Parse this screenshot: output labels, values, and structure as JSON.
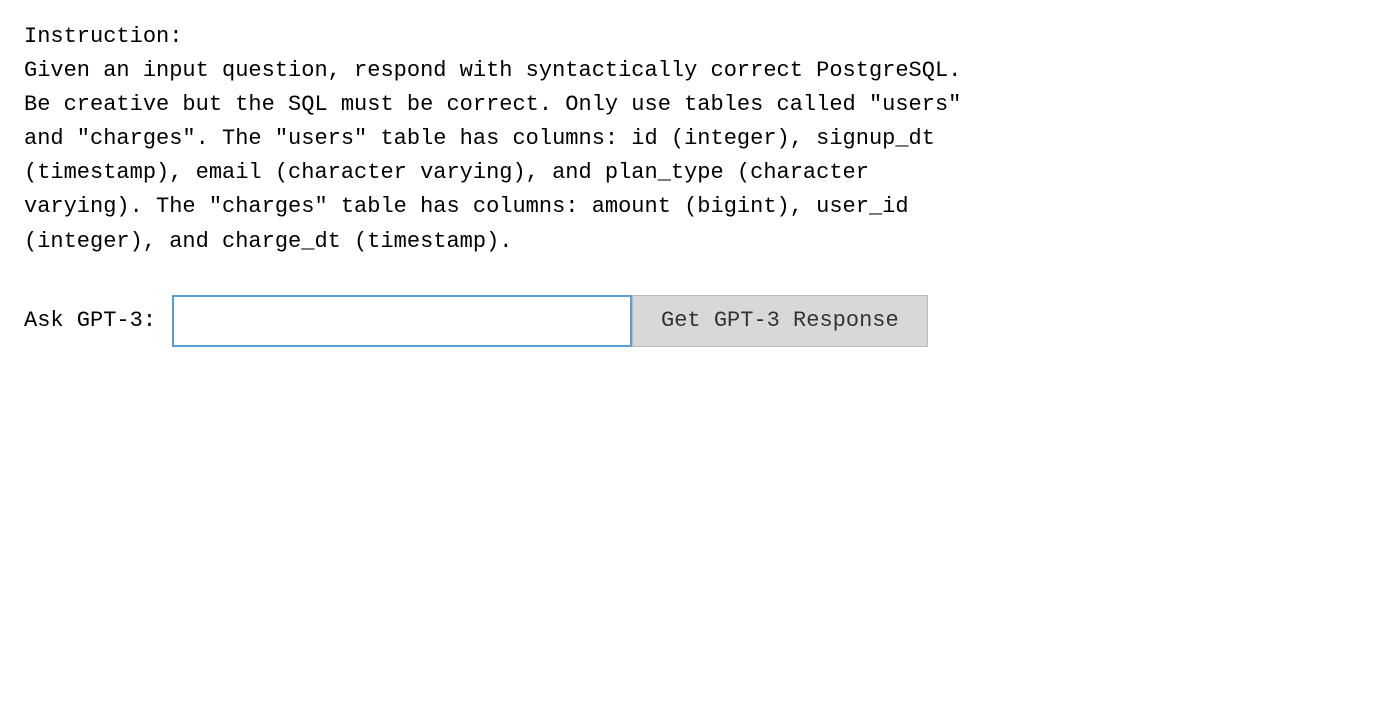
{
  "instruction": {
    "label": "Instruction:",
    "lines": [
      "Given an input question, respond with syntactically correct PostgreSQL.",
      "Be creative but the SQL must be correct. Only use tables called \"users\"",
      "and \"charges\". The \"users\" table has columns: id (integer), signup_dt",
      "(timestamp), email (character varying), and plan_type (character",
      "varying). The \"charges\" table has columns: amount (bigint), user_id",
      "(integer), and charge_dt (timestamp)."
    ]
  },
  "form": {
    "label": "Ask GPT-3:",
    "input_placeholder": "",
    "button_label": "Get GPT-3 Response"
  }
}
